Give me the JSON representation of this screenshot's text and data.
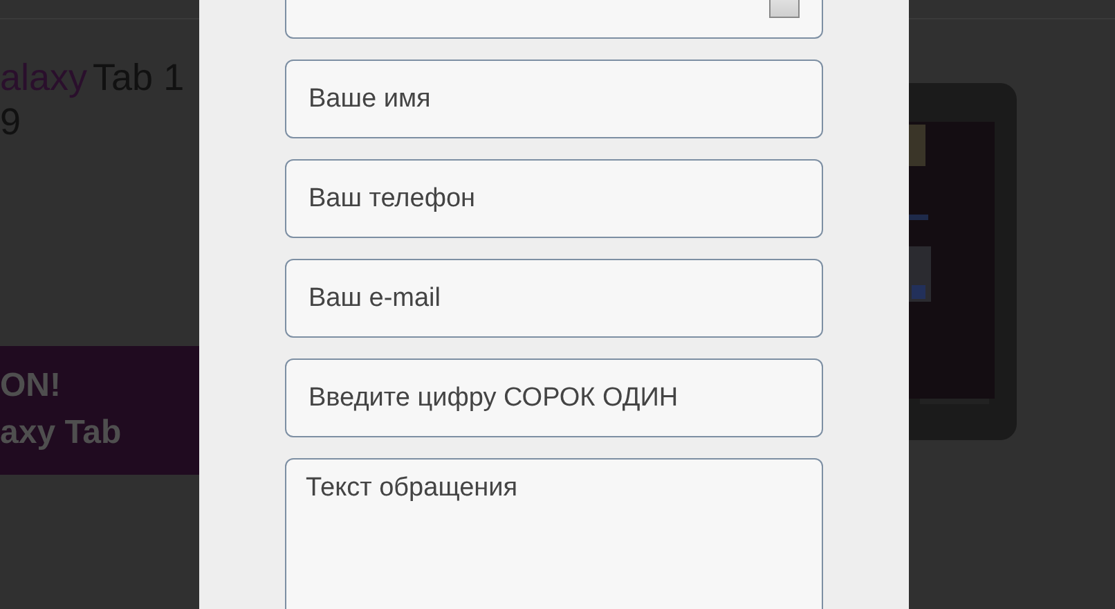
{
  "background_page": {
    "product_title": {
      "accent": "alaxy",
      "rest": "Tab 1",
      "line2": "9"
    },
    "promo_banner": {
      "lines": [
        "ON!",
        "axy Tab"
      ]
    }
  },
  "modal": {
    "fields": [
      {
        "kind": "select"
      },
      {
        "kind": "input",
        "placeholder": "Ваше имя"
      },
      {
        "kind": "input",
        "placeholder": "Ваш телефон"
      },
      {
        "kind": "input",
        "placeholder": "Ваш e-mail"
      },
      {
        "kind": "input",
        "placeholder": "Введите цифру СОРОК ОДИН"
      },
      {
        "kind": "textarea",
        "placeholder": "Текст обращения"
      }
    ]
  }
}
